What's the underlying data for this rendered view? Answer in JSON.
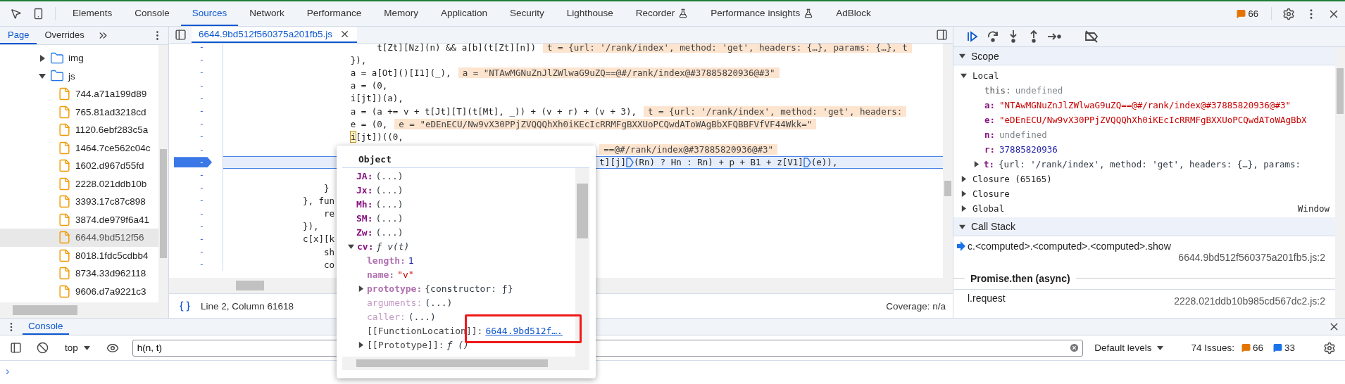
{
  "toolbar": {
    "tabs": [
      {
        "label": "Elements",
        "selected": false,
        "experimental": false
      },
      {
        "label": "Console",
        "selected": false,
        "experimental": false
      },
      {
        "label": "Sources",
        "selected": true,
        "experimental": false
      },
      {
        "label": "Network",
        "selected": false,
        "experimental": false
      },
      {
        "label": "Performance",
        "selected": false,
        "experimental": false
      },
      {
        "label": "Memory",
        "selected": false,
        "experimental": false
      },
      {
        "label": "Application",
        "selected": false,
        "experimental": false
      },
      {
        "label": "Security",
        "selected": false,
        "experimental": false
      },
      {
        "label": "Lighthouse",
        "selected": false,
        "experimental": false
      },
      {
        "label": "Recorder",
        "selected": false,
        "experimental": true
      },
      {
        "label": "Performance insights",
        "selected": false,
        "experimental": true
      },
      {
        "label": "AdBlock",
        "selected": false,
        "experimental": false
      }
    ],
    "issues_count": "66"
  },
  "navigator": {
    "tabs": [
      {
        "label": "Page",
        "selected": true
      },
      {
        "label": "Overrides",
        "selected": false
      }
    ],
    "tree": [
      {
        "label": "img",
        "kind": "folder",
        "expanded": false
      },
      {
        "label": "js",
        "kind": "folder",
        "expanded": true,
        "children": [
          {
            "label": "744.a71a199d89",
            "kind": "file",
            "selected": false
          },
          {
            "label": "765.81ad3218cd",
            "kind": "file",
            "selected": false
          },
          {
            "label": "1120.6ebf283c5a",
            "kind": "file",
            "selected": false
          },
          {
            "label": "1464.7ce562c04c",
            "kind": "file",
            "selected": false
          },
          {
            "label": "1602.d967d55fd",
            "kind": "file",
            "selected": false
          },
          {
            "label": "2228.021ddb10b",
            "kind": "file",
            "selected": false
          },
          {
            "label": "3393.17c87c898",
            "kind": "file",
            "selected": false
          },
          {
            "label": "3874.de979f6a41",
            "kind": "file",
            "selected": false
          },
          {
            "label": "6644.9bd512f56",
            "kind": "file",
            "selected": true
          },
          {
            "label": "8018.1fdc5cdbb4",
            "kind": "file",
            "selected": false
          },
          {
            "label": "8734.33d962118",
            "kind": "file",
            "selected": false
          },
          {
            "label": "9606.d7a9221c3",
            "kind": "file",
            "selected": false
          }
        ]
      }
    ]
  },
  "editor": {
    "file_tab": {
      "label": "6644.9bd512f560375a201fb5.js"
    },
    "lines": [
      {
        "number": "-",
        "paused": false,
        "code": "                            t[Zt][Nz](n) && a[b](t[Zt][n])",
        "value": "t = {url: '/rank/index', method: 'get', headers: {…}, params: {…}, t"
      },
      {
        "number": "-",
        "paused": false,
        "code": "                       }),"
      },
      {
        "number": "-",
        "paused": false,
        "code": "                       a = a[Ot]()[I1](_),",
        "value": "a = \"NTAwMGNuZnJlZWlwaG9uZQ==@#/rank/index@#37885820936@#3\""
      },
      {
        "number": "-",
        "paused": false,
        "code": "                       a = (0,"
      },
      {
        "number": "-",
        "paused": false,
        "code": "                       i[jt])(a),"
      },
      {
        "number": "-",
        "paused": false,
        "code": "                       a = (a += v + t[Jt][T](t[Mt], _)) + (v + r) + (v + 3),",
        "value": "t = {url: '/rank/index', method: 'get', headers:"
      },
      {
        "number": "-",
        "paused": false,
        "code": "                       e = (0,",
        "value": "e = \"eDEnECU/Nw9vX30PPjZVQQQhXh0iKEcIcRRMFgBXXUoPCQwdAToWAgBbXFQBBFVfVF44Wkk=\""
      },
      {
        "number": "-",
        "paused": false,
        "hovered": "                       i",
        "code": "[jt])((0,"
      },
      {
        "number": "-",
        "paused": false,
        "value": "                                                                      ==@#/rank/index@#37885820936@#3\""
      },
      {
        "number": "-",
        "paused": true,
        "code": "                                                                      t][j]",
        "continuation": [
          "(Rn) ? Hn : Rn) + p + B1 + z[V1]",
          "(e)),"
        ]
      },
      {
        "number": "-",
        "paused": false
      },
      {
        "number": "-",
        "paused": false,
        "code": "                  }"
      },
      {
        "number": "-",
        "paused": false,
        "code": "              }, fun"
      },
      {
        "number": "-",
        "paused": false,
        "code": "                  re"
      },
      {
        "number": "-",
        "paused": false,
        "code": "              }),"
      },
      {
        "number": "-",
        "paused": false,
        "code": "              c[x][k"
      },
      {
        "number": "-",
        "paused": false,
        "code": "                  sh"
      },
      {
        "number": "-",
        "paused": false,
        "code": "                  co"
      }
    ],
    "status": {
      "position": "Line 2, Column 61618",
      "coverage": "Coverage: n/a"
    }
  },
  "object_popover": {
    "title": "Object",
    "properties": [
      {
        "key": "JA:",
        "value": "(...)",
        "kind": "getter"
      },
      {
        "key": "Jx:",
        "value": "(...)",
        "kind": "getter"
      },
      {
        "key": "Mh:",
        "value": "(...)",
        "kind": "getter"
      },
      {
        "key": "SM:",
        "value": "(...)",
        "kind": "getter"
      },
      {
        "key": "Zw:",
        "value": "(...)",
        "kind": "getter"
      },
      {
        "key": "cv:",
        "value": "ƒ v(t)",
        "kind": "function",
        "expanded": true,
        "children": [
          {
            "key": "length:",
            "value": "1",
            "kind": "number",
            "internal": false
          },
          {
            "key": "name:",
            "value": "\"v\"",
            "kind": "string",
            "internal": false
          },
          {
            "key": "prototype:",
            "value": "{constructor: ƒ}",
            "kind": "object",
            "expanded": false,
            "internal": false
          },
          {
            "key": "arguments:",
            "value": "(...)",
            "kind": "getter",
            "internal": false
          },
          {
            "key": "caller:",
            "value": "(...)",
            "kind": "getter",
            "internal": false
          },
          {
            "key": "[[FunctionLocation]]:",
            "value": "6644.9bd512f….",
            "kind": "link",
            "internal": true
          },
          {
            "key": "[[Prototype]]:",
            "value": "ƒ ()",
            "kind": "function",
            "expanded": false,
            "internal": true
          }
        ]
      }
    ]
  },
  "debugger": {
    "scope": {
      "title": "Scope",
      "expanded": true,
      "local": {
        "label": "Local",
        "expanded": true,
        "variables": [
          {
            "name": "this:",
            "value": "undefined",
            "kind": "undefined"
          },
          {
            "name": "a:",
            "value": "\"NTAwMGNuZnJlZWlwaG9uZQ==@#/rank/index@#37885820936@#3\"",
            "kind": "string"
          },
          {
            "name": "e:",
            "value": "\"eDEnECU/Nw9vX30PPjZVQQQhXh0iKEcIcRRMFgBXXUoPCQwdAToWAgBbX",
            "kind": "string"
          },
          {
            "name": "n:",
            "value": "undefined",
            "kind": "undefined"
          },
          {
            "name": "r:",
            "value": "37885820936",
            "kind": "number"
          },
          {
            "name": "t:",
            "value": "{url: '/rank/index', method: 'get', headers: {…}, params:",
            "kind": "object",
            "expanded": false
          }
        ]
      },
      "groups": [
        {
          "label": "Closure (65165)",
          "expanded": false
        },
        {
          "label": "Closure",
          "expanded": false
        },
        {
          "label": "Global",
          "value": "Window",
          "expanded": false
        }
      ]
    },
    "call_stack": {
      "title": "Call Stack",
      "expanded": true,
      "frames": [
        {
          "kind": "frame",
          "function": "c.<computed>.<computed>.<computed>.show",
          "location": "6644.9bd512f560375a201fb5.js:2",
          "current": true
        },
        {
          "kind": "async",
          "label": "Promise.then (async)"
        },
        {
          "kind": "frame",
          "function": "l.request",
          "location": "2228.021ddb10b985cd567dc2.js:2",
          "current": false
        }
      ]
    }
  },
  "console": {
    "tab": {
      "label": "Console",
      "selected": true
    },
    "context": "top",
    "filter": {
      "value": "h(n, t)"
    },
    "levels": "Default levels",
    "issues": {
      "label": "74 Issues:",
      "warnings": "66",
      "info": "33"
    },
    "prompt": "›"
  }
}
